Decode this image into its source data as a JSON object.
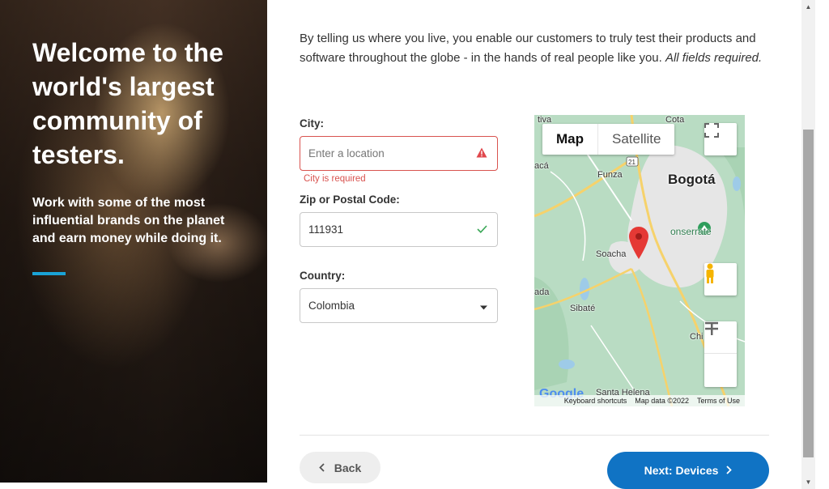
{
  "hero": {
    "title": "Welcome to the world's largest community of testers.",
    "subtitle": "Work with some of the most influential brands on the planet and earn money while doing it.",
    "accent_color": "#1aa3d6"
  },
  "form": {
    "intro": "By telling us where you live, you enable our customers to truly test their products and software throughout the globe - in the hands of real people like you.",
    "intro_emphasis": "All fields required.",
    "city": {
      "label": "City:",
      "placeholder": "Enter a location",
      "error": "City is required",
      "status_icon": "warning-icon"
    },
    "zip": {
      "label": "Zip or Postal Code:",
      "value": "111931",
      "status_icon": "check-icon"
    },
    "country": {
      "label": "Country:",
      "value": "Colombia"
    }
  },
  "map": {
    "tab_map": "Map",
    "tab_satellite": "Satellite",
    "places": {
      "bogota": "Bogotá",
      "soacha": "Soacha",
      "funza": "Funza",
      "sibate": "Sibaté",
      "cota": "Cota",
      "tiva": "tiva",
      "aca": "acá",
      "ada": "ada",
      "chi": "Chi",
      "santa_helena": "Santa Helena",
      "monserrate": "onserrate",
      "route": "21"
    },
    "logo": "Google",
    "footer": {
      "shortcuts": "Keyboard shortcuts",
      "map_data": "Map data ©2022",
      "terms": "Terms of Use"
    }
  },
  "nav": {
    "back": "Back",
    "next": "Next: Devices",
    "next_color": "#1073c4"
  },
  "colors": {
    "error": "#d9534f",
    "success": "#3aa757"
  }
}
